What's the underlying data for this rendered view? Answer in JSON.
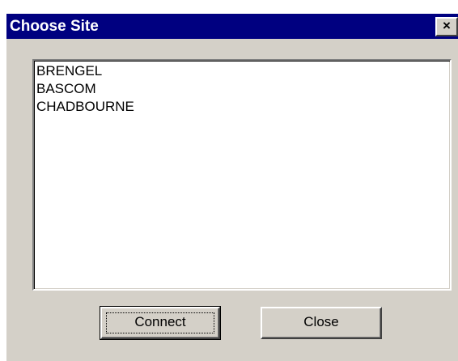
{
  "dialog": {
    "title": "Choose Site",
    "close_glyph": "×",
    "close_icon": "close-icon"
  },
  "site_list": {
    "items": [
      "BRENGEL",
      "BASCOM",
      "CHADBOURNE"
    ]
  },
  "buttons": {
    "connect_label": "Connect",
    "close_label": "Close"
  },
  "colors": {
    "titlebar": "#000080",
    "face": "#d4d0c8",
    "list_background": "#ffffff"
  }
}
